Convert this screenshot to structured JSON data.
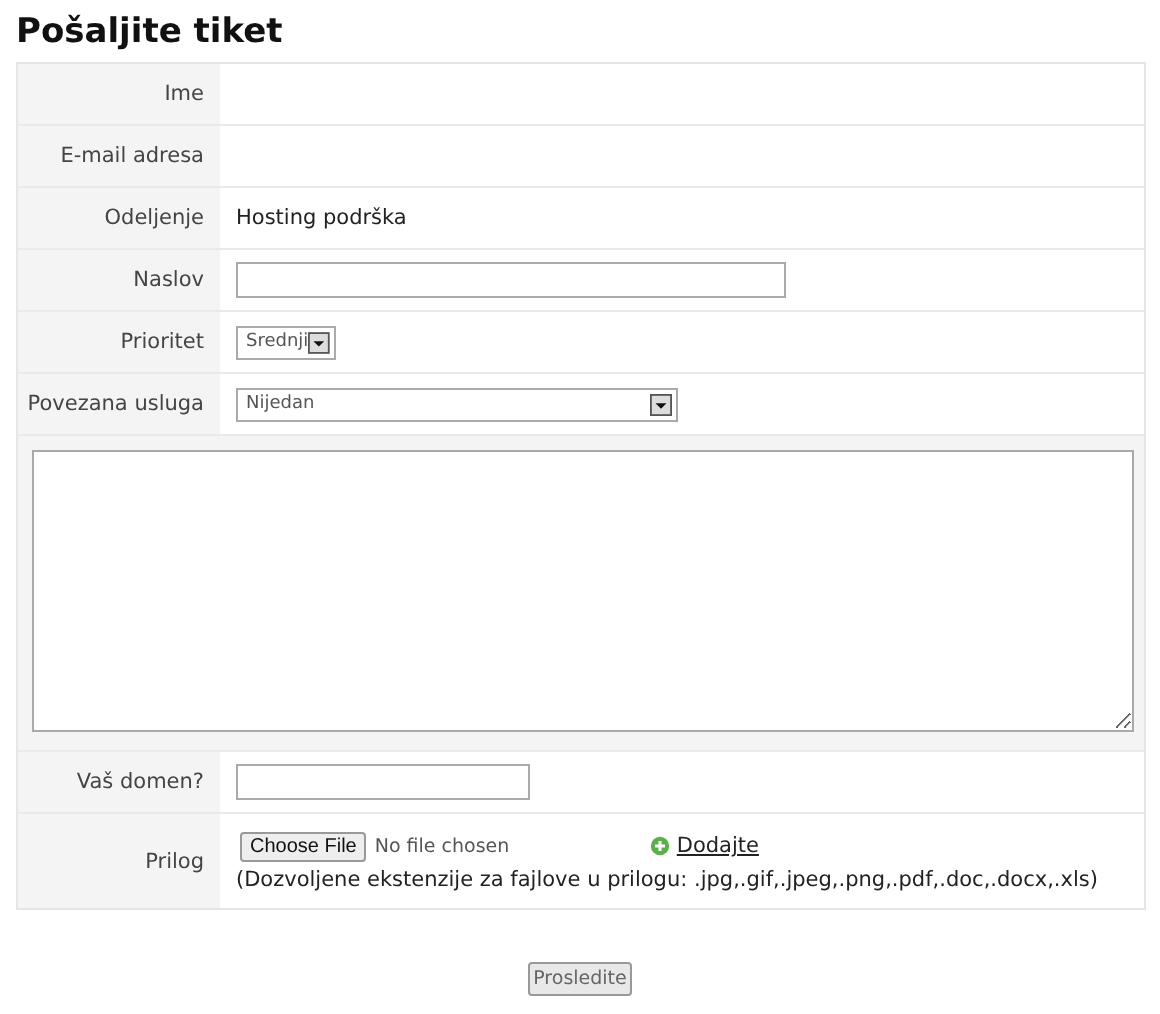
{
  "title": "Pošaljite tiket",
  "fields": [
    {
      "kind": "blank",
      "label": "Ime"
    },
    {
      "kind": "blank",
      "label": "E-mail adresa"
    },
    {
      "kind": "text",
      "label": "Odeljenje",
      "value": "Hosting podrška"
    },
    {
      "kind": "longinput",
      "label": "Naslov"
    },
    {
      "kind": "smallselect",
      "label": "Prioritet",
      "value": "Srednji"
    },
    {
      "kind": "select",
      "label": "Povezana usluga",
      "value": "Nijedan"
    },
    {
      "kind": "message"
    },
    {
      "kind": "shortinput",
      "label": "Vaš domen?"
    },
    {
      "kind": "file",
      "label": "Prilog",
      "button": "Choose File",
      "status": "No file chosen",
      "link": "Dodajte",
      "note": "(Dozvoljene ekstenzije za fajlove u prilogu: .jpg,.gif,.jpeg,.png,.pdf,.doc,.docx,.xls)"
    }
  ],
  "submit": "Prosledite"
}
